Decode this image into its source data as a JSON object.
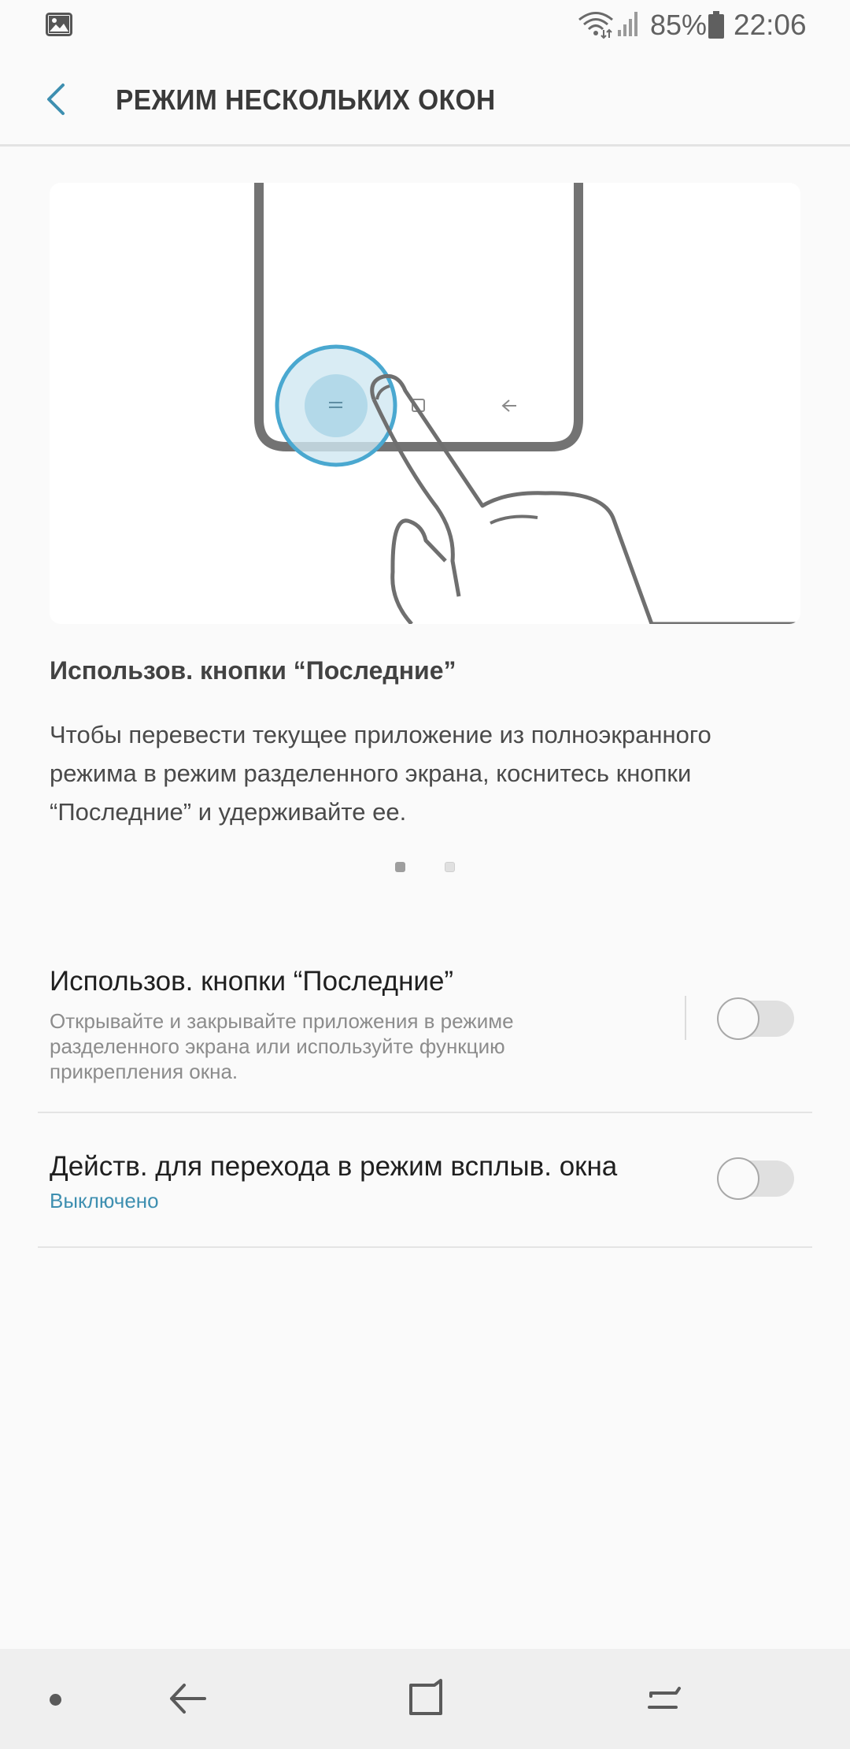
{
  "status_bar": {
    "battery_percent": "85%",
    "time": "22:06",
    "icons": [
      "gallery-icon",
      "wifi-icon",
      "signal-icon",
      "battery-icon"
    ]
  },
  "header": {
    "title": "РЕЖИМ НЕСКОЛЬКИХ ОКОН",
    "back_icon": "chevron-left-icon"
  },
  "tutorial": {
    "heading": "Использов. кнопки “Последние”",
    "description_lines": [
      "Чтобы перевести текущее приложение из полноэкранного",
      "режима в режим разделенного экрана, коснитесь кнопки",
      "“Последние” и удерживайте ее."
    ],
    "page_count": 2,
    "current_page": 1
  },
  "settings": [
    {
      "title": "Использов. кнопки “Последние”",
      "subtitle_lines": [
        "Открывайте и закрывайте приложения в режиме",
        "разделенного экрана или используйте функцию",
        "прикрепления окна."
      ],
      "enabled": false
    },
    {
      "title": "Действ. для перехода в режим всплыв. окна",
      "status": "Выключено",
      "enabled": false
    }
  ],
  "nav_bar": {
    "buttons": [
      "keyboard-dot-icon",
      "back-icon",
      "home-icon",
      "recents-icon"
    ]
  },
  "colors": {
    "accent": "#3e8fb0",
    "background": "#fafafa",
    "highlight_circle": "#4aa8d0"
  }
}
